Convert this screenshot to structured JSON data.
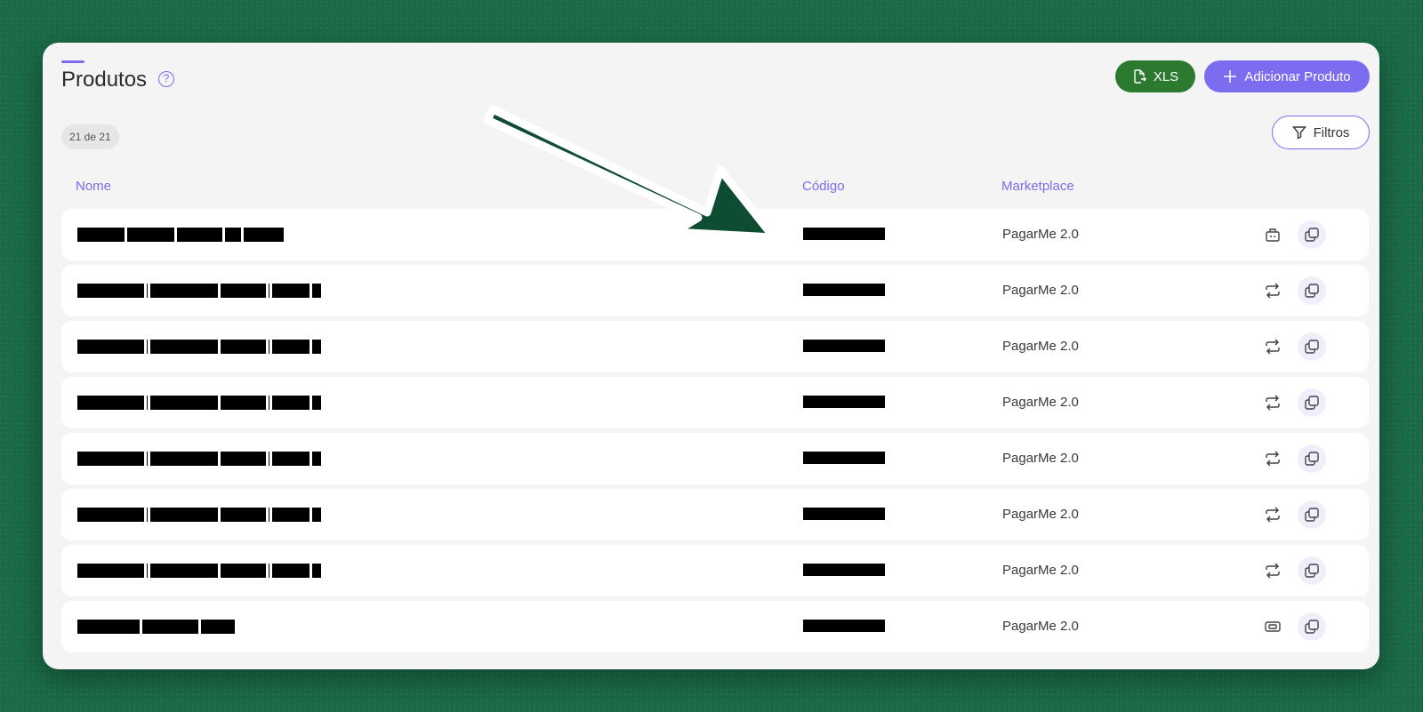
{
  "header": {
    "title": "Produtos",
    "help_glyph": "?",
    "xls_label": "XLS",
    "add_label": "Adicionar Produto",
    "filter_label": "Filtros",
    "count_text": "21 de 21"
  },
  "table": {
    "columns": [
      "Nome",
      "Código",
      "Marketplace"
    ],
    "rows": [
      {
        "marketplace": "PagarMe 2.0",
        "action_icon": "package-icon"
      },
      {
        "marketplace": "PagarMe 2.0",
        "action_icon": "recurring-icon"
      },
      {
        "marketplace": "PagarMe 2.0",
        "action_icon": "recurring-icon"
      },
      {
        "marketplace": "PagarMe 2.0",
        "action_icon": "recurring-icon"
      },
      {
        "marketplace": "PagarMe 2.0",
        "action_icon": "recurring-icon"
      },
      {
        "marketplace": "PagarMe 2.0",
        "action_icon": "recurring-icon"
      },
      {
        "marketplace": "PagarMe 2.0",
        "action_icon": "recurring-icon"
      },
      {
        "marketplace": "PagarMe 2.0",
        "action_icon": "ticket-icon"
      }
    ]
  },
  "colors": {
    "accent": "#7c6cf0",
    "xls": "#2c7a30",
    "background": "#1a6b47",
    "arrow": "#0f4d33"
  }
}
